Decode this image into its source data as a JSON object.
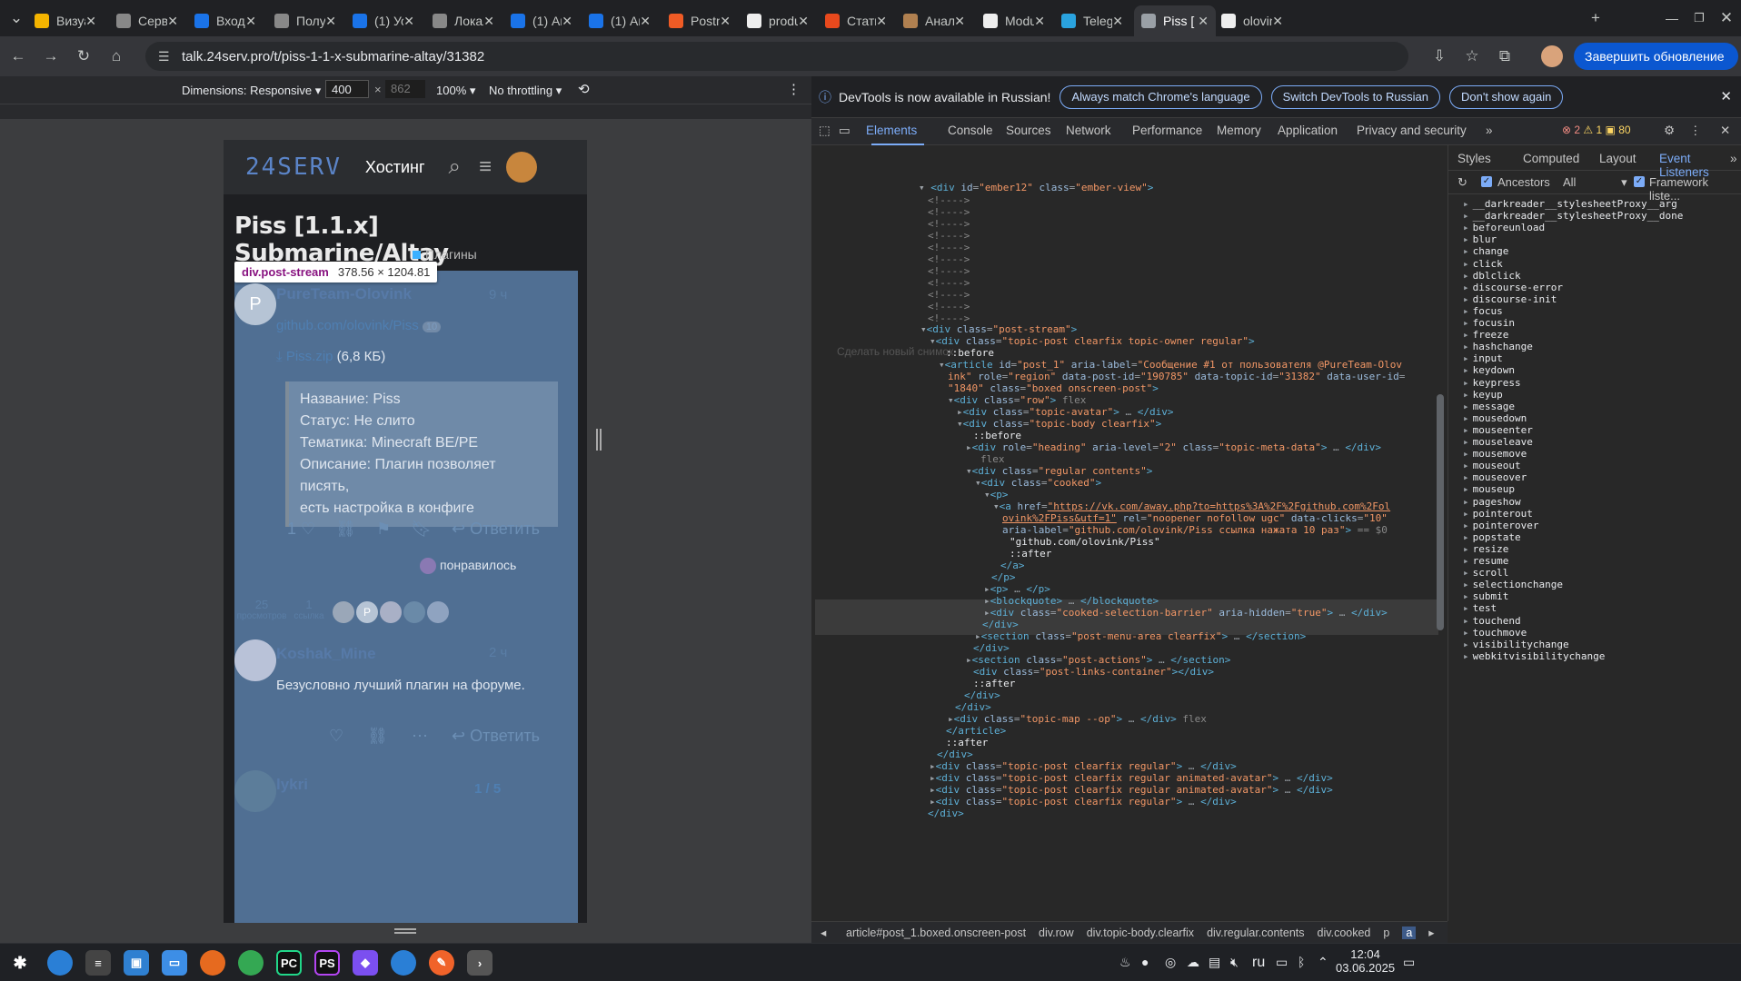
{
  "tabs": [
    {
      "title": "Визуа",
      "color": "#f4b400"
    },
    {
      "title": "Серве",
      "color": "#888"
    },
    {
      "title": "Входя",
      "color": "#1a73e8"
    },
    {
      "title": "Получ",
      "color": "#888"
    },
    {
      "title": "(1) Ус",
      "color": "#1a73e8"
    },
    {
      "title": "Локал",
      "color": "#888"
    },
    {
      "title": "(1) Ан",
      "color": "#1a73e8"
    },
    {
      "title": "(1) Ан",
      "color": "#1a73e8"
    },
    {
      "title": "Postm",
      "color": "#ef5b25"
    },
    {
      "title": "produ",
      "color": "#eee"
    },
    {
      "title": "Стати",
      "color": "#e8491d"
    },
    {
      "title": "Анали",
      "color": "#b08050"
    },
    {
      "title": "Modu",
      "color": "#eee"
    },
    {
      "title": "Teleg",
      "color": "#2aa3df"
    },
    {
      "title": "Piss [",
      "color": "#9aa0a6"
    },
    {
      "title": "olovin",
      "color": "#eee"
    }
  ],
  "url": "talk.24serv.pro/t/piss-1-1-x-submarine-altay/31382",
  "update_button": "Завершить обновление",
  "device": {
    "dimensions": "Dimensions: Responsive",
    "width": "400",
    "height": "862",
    "zoom": "100%",
    "throttle": "No throttling"
  },
  "page": {
    "logo": "24SERV",
    "nav_label": "Хостинг",
    "title": "Piss [1.1.x] Submarine/Altay",
    "category": "Плагины",
    "tooltip": {
      "selector": "div.post-stream",
      "size": "378.56 × 1204.81"
    },
    "post1": {
      "avatar": "P",
      "user": "PureTeam-Olovink",
      "time": "9 ч",
      "link": "github.com/olovink/Piss",
      "link_clicks": "10",
      "file": "Piss.zip",
      "file_size": "(6,8 КБ)",
      "quote": [
        "Название: Piss",
        "Статус: Не слито",
        "Тематика: Minecraft BE/PE",
        "Описание: Плагин позволяет писять,",
        "есть настройка в конфиге"
      ],
      "likes": "1",
      "reply": "Ответить",
      "liked_text": "понравилось"
    },
    "stats": {
      "views": "25",
      "views_label": "просмотров",
      "links": "1",
      "links_label": "ссылка"
    },
    "post2": {
      "user": "Koshak_Mine",
      "time": "2 ч",
      "text": "Безусловно лучший плагин на форуме.",
      "reply": "Ответить"
    },
    "post3": {
      "user": "lykri",
      "progress": "1 / 5"
    }
  },
  "devtools": {
    "banner": "DevTools is now available in Russian!",
    "banner_buttons": [
      "Always match Chrome's language",
      "Switch DevTools to Russian",
      "Don't show again"
    ],
    "tabs": [
      "Elements",
      "Console",
      "Sources",
      "Network",
      "Performance",
      "Memory",
      "Application",
      "Privacy and security"
    ],
    "errors": "2",
    "warnings": "1",
    "info": "80",
    "side_tabs": [
      "Styles",
      "Computed",
      "Layout",
      "Event Listeners"
    ],
    "ancestors": "Ancestors",
    "all": "All",
    "framework": "Framework liste...",
    "screenshot_hint": "Сделать новый снимок",
    "events": [
      "__darkreader__stylesheetProxy__arg",
      "__darkreader__stylesheetProxy__done",
      "beforeunload",
      "blur",
      "change",
      "click",
      "dblclick",
      "discourse-error",
      "discourse-init",
      "focus",
      "focusin",
      "freeze",
      "hashchange",
      "input",
      "keydown",
      "keypress",
      "keyup",
      "message",
      "mousedown",
      "mouseenter",
      "mouseleave",
      "mousemove",
      "mouseout",
      "mouseover",
      "mouseup",
      "pageshow",
      "pointerout",
      "pointerover",
      "popstate",
      "resize",
      "resume",
      "scroll",
      "selectionchange",
      "submit",
      "test",
      "touchend",
      "touchmove",
      "visibilitychange",
      "webkitvisibilitychange"
    ],
    "crumbs": [
      "article#post_1.boxed.onscreen-post",
      "div.row",
      "div.topic-body.clearfix",
      "div.regular.contents",
      "div.cooked",
      "p",
      "a"
    ]
  },
  "taskbar": {
    "lang": "ru",
    "time": "12:04",
    "date": "03.06.2025"
  }
}
